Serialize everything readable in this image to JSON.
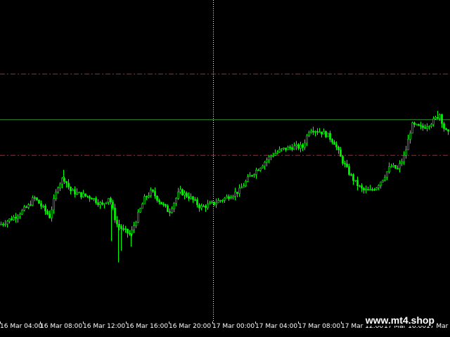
{
  "chart_data": {
    "type": "candlestick",
    "candle_color": "#00ff00",
    "background": "#000000",
    "y_range": [
      0,
      100
    ],
    "grid": false,
    "crosshair_time": "17 Mar 00:00",
    "levels": [
      {
        "kind": "resistance-dashdot",
        "color": "#e01010",
        "value": 77.0
      },
      {
        "kind": "horizontal-line",
        "color": "#2e8b2e",
        "value": 62.8
      },
      {
        "kind": "support-dashdot",
        "color": "#e01010",
        "value": 51.7
      }
    ],
    "time_ticks": [
      "16 Mar 04:00",
      "16 Mar 08:00",
      "16 Mar 12:00",
      "16 Mar 16:00",
      "16 Mar 20:00",
      "17 Mar 00:00",
      "17 Mar 04:00",
      "17 Mar 08:00",
      "17 Mar 12:00",
      "17 Mar 16:00",
      "17 Mar"
    ],
    "close_path": [
      [
        0,
        30.2
      ],
      [
        20,
        32.5
      ],
      [
        40,
        35.9
      ],
      [
        48,
        38.6
      ],
      [
        60,
        35.5
      ],
      [
        70,
        32.7
      ],
      [
        82,
        42.3
      ],
      [
        90,
        44.8
      ],
      [
        100,
        40.7
      ],
      [
        115,
        39.4
      ],
      [
        130,
        38.6
      ],
      [
        145,
        36.1
      ],
      [
        155,
        38.9
      ],
      [
        165,
        30.5
      ],
      [
        175,
        28.4
      ],
      [
        185,
        27.0
      ],
      [
        195,
        32.7
      ],
      [
        205,
        38.2
      ],
      [
        215,
        40.5
      ],
      [
        225,
        37.8
      ],
      [
        240,
        34.1
      ],
      [
        255,
        40.5
      ],
      [
        270,
        38.6
      ],
      [
        285,
        35.5
      ],
      [
        300,
        36.5
      ],
      [
        320,
        38.4
      ],
      [
        340,
        40.7
      ],
      [
        355,
        45.2
      ],
      [
        370,
        48.3
      ],
      [
        385,
        51.7
      ],
      [
        400,
        53.4
      ],
      [
        415,
        54.3
      ],
      [
        430,
        54.3
      ],
      [
        440,
        60.0
      ],
      [
        455,
        59.1
      ],
      [
        465,
        58.0
      ],
      [
        475,
        55.7
      ],
      [
        485,
        50.6
      ],
      [
        495,
        46.6
      ],
      [
        505,
        43.2
      ],
      [
        515,
        40.9
      ],
      [
        525,
        40.5
      ],
      [
        535,
        42.0
      ],
      [
        545,
        44.8
      ],
      [
        555,
        48.3
      ],
      [
        565,
        47.4
      ],
      [
        575,
        51.7
      ],
      [
        585,
        61.1
      ],
      [
        600,
        60.2
      ],
      [
        615,
        62.2
      ],
      [
        625,
        64.5
      ],
      [
        632,
        59.5
      ],
      [
        640,
        57.8
      ]
    ]
  },
  "axis": {
    "labels": [
      "16 Mar 04:00",
      "16 Mar 08:00",
      "16 Mar 12:00",
      "16 Mar 16:00",
      "16 Mar 20:00",
      "17 Mar 00:00",
      "17 Mar 04:00",
      "17 Mar 08:00",
      "17 Mar 12:00",
      "17 Mar 16:00",
      "17 Mar"
    ]
  },
  "watermark": "www.mt4.shop"
}
